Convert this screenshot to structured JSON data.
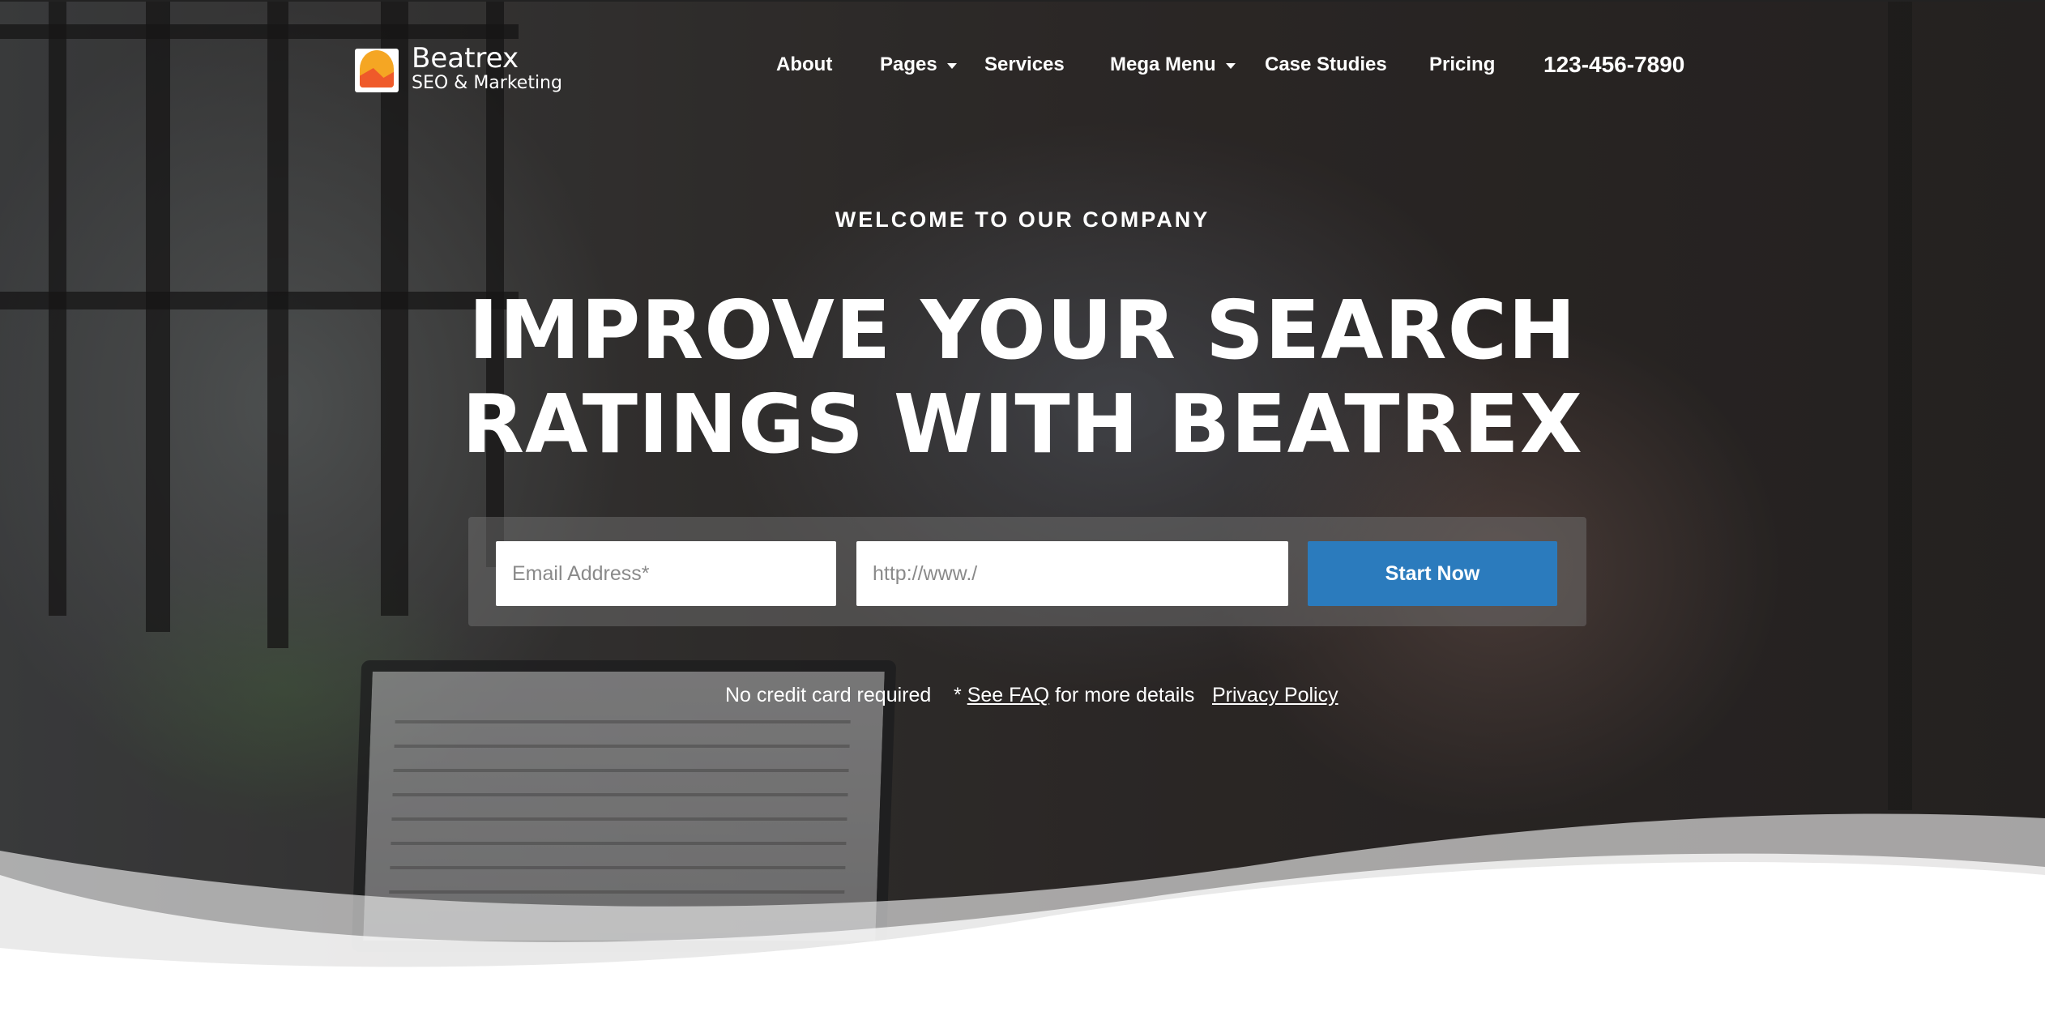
{
  "brand": {
    "name": "Beatrex",
    "tagline": "SEO & Marketing"
  },
  "nav": {
    "items": [
      {
        "label": "About",
        "has_dropdown": false
      },
      {
        "label": "Pages",
        "has_dropdown": true
      },
      {
        "label": "Services",
        "has_dropdown": false
      },
      {
        "label": "Mega Menu",
        "has_dropdown": true
      },
      {
        "label": "Case Studies",
        "has_dropdown": false
      },
      {
        "label": "Pricing",
        "has_dropdown": false
      }
    ],
    "phone": "123-456-7890"
  },
  "hero": {
    "eyebrow": "WELCOME TO OUR COMPANY",
    "headline_line1": "IMPROVE YOUR SEARCH",
    "headline_line2": "RATINGS WITH BEATREX"
  },
  "form": {
    "email_placeholder": "Email Address*",
    "email_value": "",
    "url_placeholder": "http://www./",
    "url_value": "",
    "submit_label": "Start Now"
  },
  "notes": {
    "no_card": "No credit card required",
    "faq_prefix": "* ",
    "faq_link": "See FAQ",
    "faq_suffix": " for more details",
    "privacy_link": "Privacy Policy"
  },
  "colors": {
    "accent": "#2b7bbd",
    "logo_orange": "#f5a623",
    "logo_red": "#ef5a2a",
    "text": "#ffffff"
  },
  "icons": [
    "logo-mark",
    "chevron-down-icon"
  ]
}
